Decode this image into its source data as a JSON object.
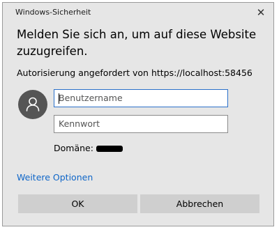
{
  "window": {
    "title": "Windows-Sicherheit",
    "close_glyph": "✕"
  },
  "prompt": {
    "heading": "Melden Sie sich an, um auf diese Website zuzugreifen.",
    "authorization": "Autorisierung angefordert von https://localhost:58456"
  },
  "form": {
    "username_placeholder": "Benutzername",
    "password_placeholder": "Kennwort",
    "domain_label": "Domäne:"
  },
  "links": {
    "more_options": "Weitere Optionen"
  },
  "buttons": {
    "ok": "OK",
    "cancel": "Abbrechen"
  },
  "icons": {
    "avatar": "user-avatar-icon",
    "close": "close-icon"
  },
  "colors": {
    "dialog_bg": "#e6e6e6",
    "focus_border": "#2a6fc9",
    "link": "#0f66c8",
    "avatar_bg": "#555555",
    "button_bg": "#cfcfcf"
  }
}
